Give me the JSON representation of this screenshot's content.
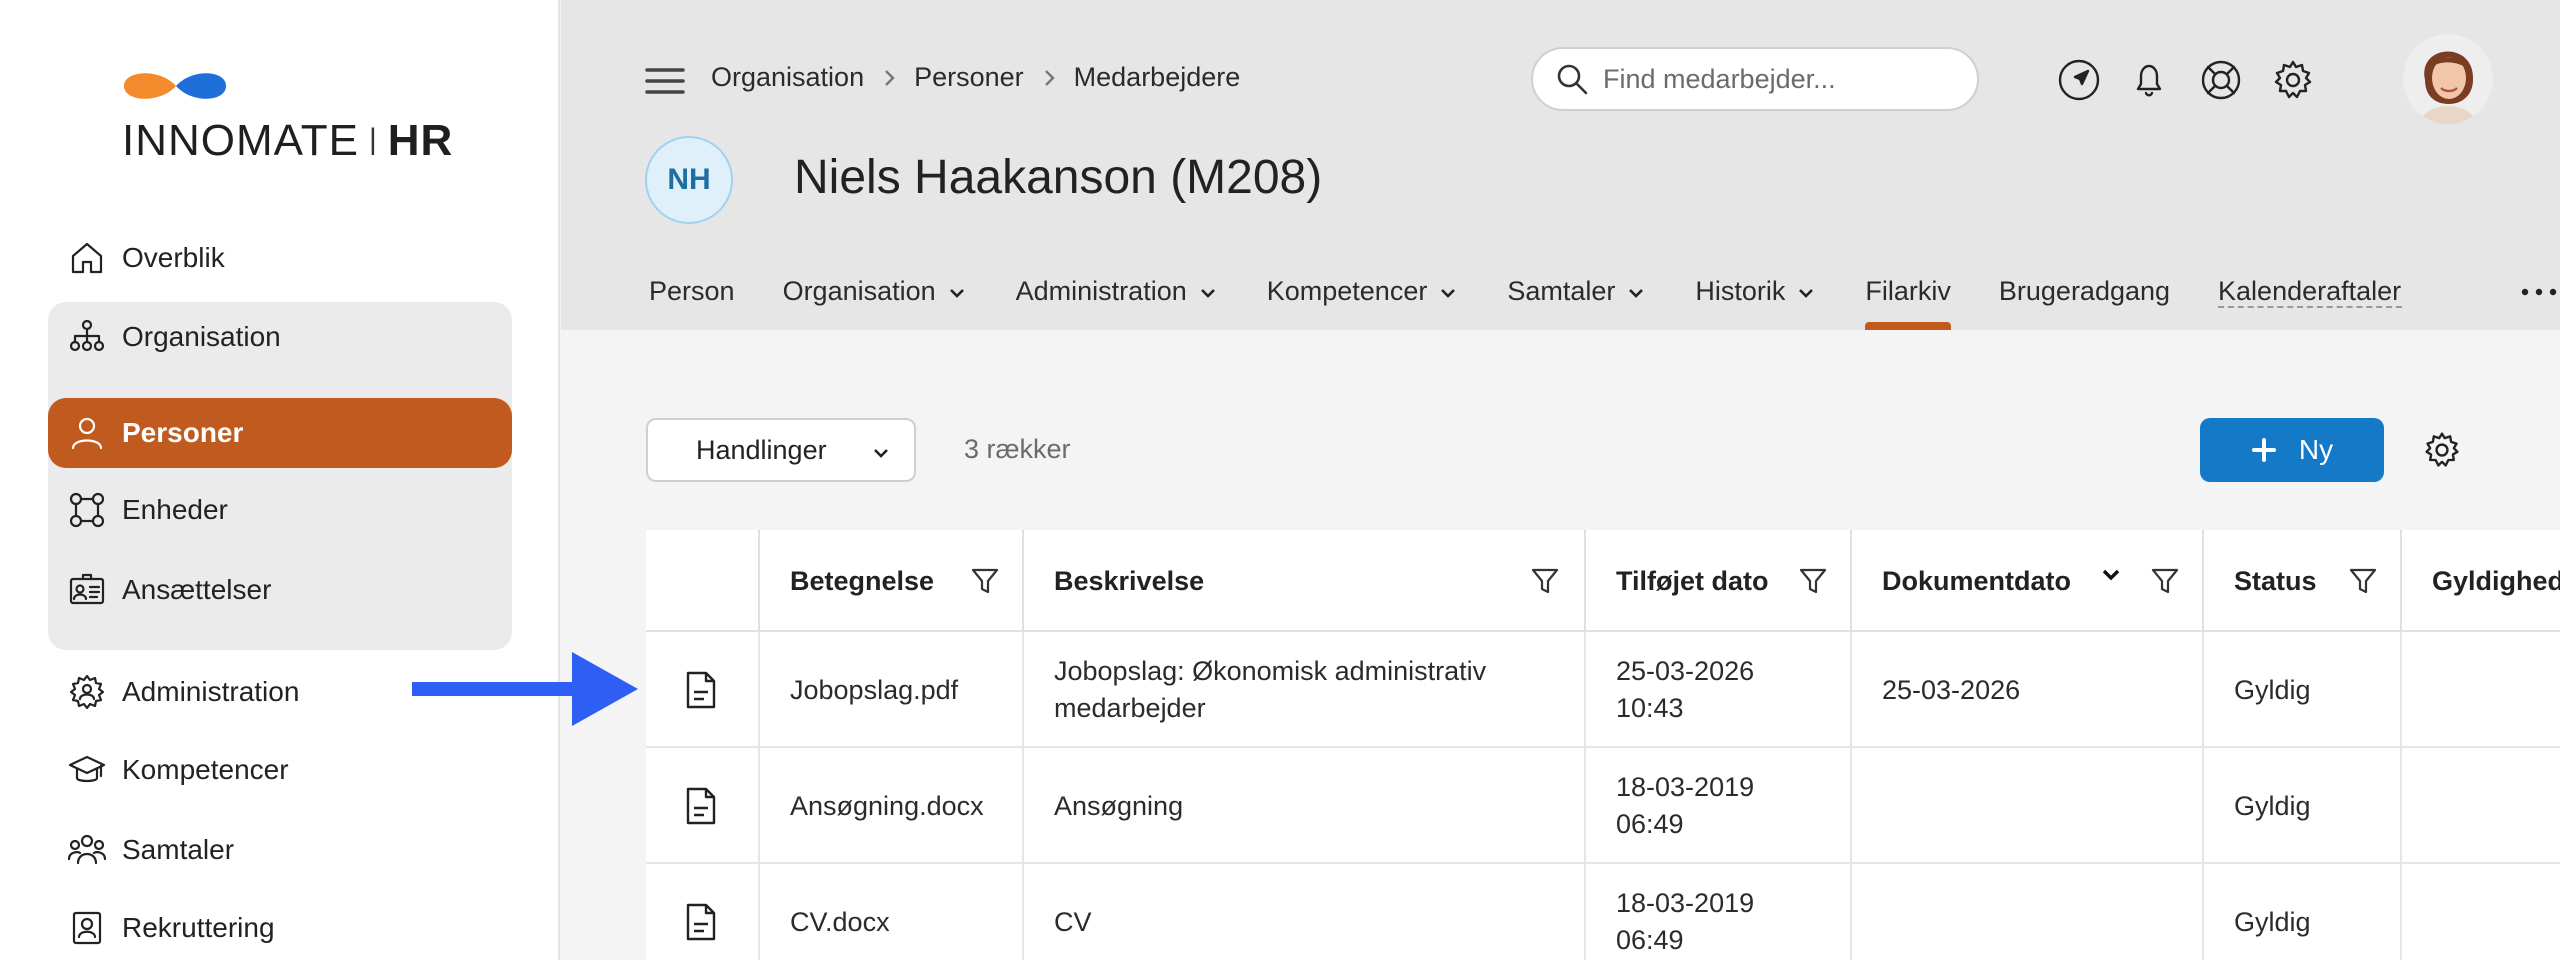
{
  "brand": {
    "name_light": "INNO",
    "name_bold": "MATE",
    "suffix": "HR",
    "colors": {
      "orange": "#f38a2b",
      "blue": "#1e6fd8"
    }
  },
  "sidebar": {
    "items": [
      {
        "label": "Overblik",
        "icon": "home-icon"
      },
      {
        "label": "Organisation",
        "icon": "org-chart-icon"
      },
      {
        "label": "Personer",
        "icon": "person-icon",
        "active": true
      },
      {
        "label": "Enheder",
        "icon": "units-icon"
      },
      {
        "label": "Ansættelser",
        "icon": "id-card-icon"
      },
      {
        "label": "Administration",
        "icon": "gear-person-icon"
      },
      {
        "label": "Kompetencer",
        "icon": "graduation-cap-icon"
      },
      {
        "label": "Samtaler",
        "icon": "people-icon"
      },
      {
        "label": "Rekruttering",
        "icon": "badge-icon"
      }
    ],
    "active_color": "#c05a1e"
  },
  "header": {
    "breadcrumb": [
      "Organisation",
      "Personer",
      "Medarbejdere"
    ],
    "search_placeholder": "Find medarbejder...",
    "icons": [
      "navigate-icon",
      "bell-icon",
      "lifebuoy-icon",
      "gear-icon"
    ]
  },
  "employee": {
    "initials": "NH",
    "name": "Niels Haakanson (M208)"
  },
  "tabs": [
    {
      "label": "Person",
      "dropdown": false
    },
    {
      "label": "Organisation",
      "dropdown": true
    },
    {
      "label": "Administration",
      "dropdown": true
    },
    {
      "label": "Kompetencer",
      "dropdown": true
    },
    {
      "label": "Samtaler",
      "dropdown": true
    },
    {
      "label": "Historik",
      "dropdown": true
    },
    {
      "label": "Filarkiv",
      "dropdown": false,
      "active": true
    },
    {
      "label": "Brugeradgang",
      "dropdown": false
    },
    {
      "label": "Kalenderaftaler",
      "dropdown": false
    }
  ],
  "toolbar": {
    "actions_label": "Handlinger",
    "row_count": "3 rækker",
    "new_label": "Ny",
    "new_color": "#1479c7"
  },
  "table": {
    "columns": [
      "Betegnelse",
      "Beskrivelse",
      "Tilføjet dato",
      "Dokumentdato",
      "Status",
      "Gyldighed"
    ],
    "rows": [
      {
        "name": "Jobopslag.pdf",
        "desc": "Jobopslag: Økonomisk administrativ medarbejder",
        "added_date": "25-03-2026",
        "added_time": "10:43",
        "doc_date": "25-03-2026",
        "status": "Gyldig"
      },
      {
        "name": "Ansøgning.docx",
        "desc": "Ansøgning",
        "added_date": "18-03-2019",
        "added_time": "06:49",
        "doc_date": "",
        "status": "Gyldig"
      },
      {
        "name": "CV.docx",
        "desc": "CV",
        "added_date": "18-03-2019",
        "added_time": "06:49",
        "doc_date": "",
        "status": "Gyldig"
      }
    ]
  },
  "annotation": {
    "arrow_color": "#2f5ef5"
  }
}
